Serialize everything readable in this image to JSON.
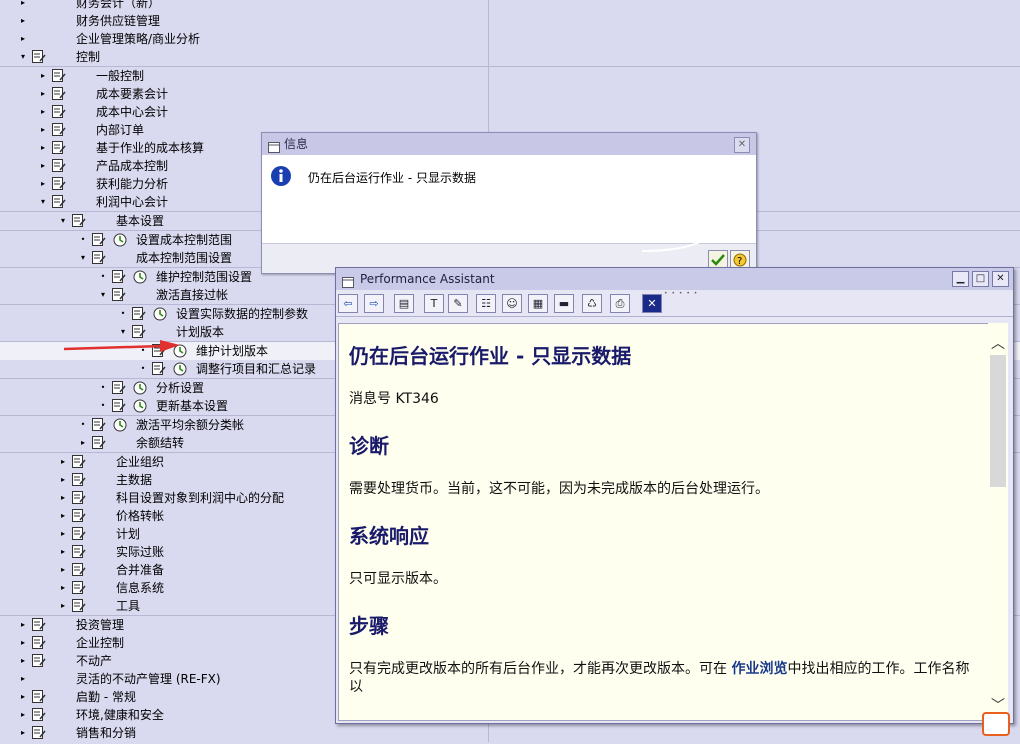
{
  "tree": [
    {
      "label": "财务会计（新）",
      "level": 0,
      "exp": "▸",
      "icon": "none",
      "sep": false
    },
    {
      "label": "财务供应链管理",
      "level": 0,
      "exp": "▸",
      "icon": "none",
      "sep": false
    },
    {
      "label": "企业管理策略/商业分析",
      "level": 0,
      "exp": "▸",
      "icon": "none",
      "sep": false
    },
    {
      "label": "控制",
      "level": 0,
      "exp": "▾",
      "icon": "doc",
      "sep": true
    },
    {
      "label": "一般控制",
      "level": 1,
      "exp": "▸",
      "icon": "doc",
      "sep": false
    },
    {
      "label": "成本要素会计",
      "level": 1,
      "exp": "▸",
      "icon": "doc",
      "sep": false
    },
    {
      "label": "成本中心会计",
      "level": 1,
      "exp": "▸",
      "icon": "doc",
      "sep": false
    },
    {
      "label": "内部订单",
      "level": 1,
      "exp": "▸",
      "icon": "doc",
      "sep": false
    },
    {
      "label": "基于作业的成本核算",
      "level": 1,
      "exp": "▸",
      "icon": "doc",
      "sep": false
    },
    {
      "label": "产品成本控制",
      "level": 1,
      "exp": "▸",
      "icon": "doc",
      "sep": false
    },
    {
      "label": "获利能力分析",
      "level": 1,
      "exp": "▸",
      "icon": "doc",
      "sep": false
    },
    {
      "label": "利润中心会计",
      "level": 1,
      "exp": "▾",
      "icon": "doc",
      "sep": true
    },
    {
      "label": "基本设置",
      "level": 2,
      "exp": "▾",
      "icon": "doc",
      "sep": true
    },
    {
      "label": "设置成本控制范围",
      "level": 3,
      "exp": "•",
      "icon": "doc-clock",
      "sep": false
    },
    {
      "label": "成本控制范围设置",
      "level": 3,
      "exp": "▾",
      "icon": "doc",
      "sep": true
    },
    {
      "label": "维护控制范围设置",
      "level": 4,
      "exp": "•",
      "icon": "doc-clock",
      "sep": false
    },
    {
      "label": "激活直接过帐",
      "level": 4,
      "exp": "▾",
      "icon": "doc",
      "sep": true
    },
    {
      "label": "设置实际数据的控制参数",
      "level": 5,
      "exp": "•",
      "icon": "doc-clock",
      "sep": false
    },
    {
      "label": "计划版本",
      "level": 5,
      "exp": "▾",
      "icon": "doc",
      "sep": true
    },
    {
      "label": "维护计划版本",
      "level": 6,
      "exp": "•",
      "icon": "doc-clock",
      "sep": false,
      "highlight": true
    },
    {
      "label": "调整行项目和汇总记录",
      "level": 6,
      "exp": "•",
      "icon": "doc-clock",
      "sep": true
    },
    {
      "label": "分析设置",
      "level": 4,
      "exp": "•",
      "icon": "doc-clock",
      "sep": false
    },
    {
      "label": "更新基本设置",
      "level": 4,
      "exp": "•",
      "icon": "doc-clock",
      "sep": true
    },
    {
      "label": "激活平均余额分类帐",
      "level": 3,
      "exp": "•",
      "icon": "doc-clock",
      "sep": false
    },
    {
      "label": "余额结转",
      "level": 3,
      "exp": "▸",
      "icon": "doc",
      "sep": true
    },
    {
      "label": "企业组织",
      "level": 2,
      "exp": "▸",
      "icon": "doc",
      "sep": false
    },
    {
      "label": "主数据",
      "level": 2,
      "exp": "▸",
      "icon": "doc",
      "sep": false
    },
    {
      "label": "科目设置对象到利润中心的分配",
      "level": 2,
      "exp": "▸",
      "icon": "doc",
      "sep": false
    },
    {
      "label": "价格转帐",
      "level": 2,
      "exp": "▸",
      "icon": "doc",
      "sep": false
    },
    {
      "label": "计划",
      "level": 2,
      "exp": "▸",
      "icon": "doc",
      "sep": false
    },
    {
      "label": "实际过账",
      "level": 2,
      "exp": "▸",
      "icon": "doc",
      "sep": false
    },
    {
      "label": "合并准备",
      "level": 2,
      "exp": "▸",
      "icon": "doc",
      "sep": false
    },
    {
      "label": "信息系统",
      "level": 2,
      "exp": "▸",
      "icon": "doc",
      "sep": false
    },
    {
      "label": "工具",
      "level": 2,
      "exp": "▸",
      "icon": "doc",
      "sep": true
    },
    {
      "label": "投资管理",
      "level": 0,
      "exp": "▸",
      "icon": "doc",
      "sep": false
    },
    {
      "label": "企业控制",
      "level": 0,
      "exp": "▸",
      "icon": "doc",
      "sep": false
    },
    {
      "label": "不动产",
      "level": 0,
      "exp": "▸",
      "icon": "doc",
      "sep": false
    },
    {
      "label": "灵活的不动产管理 (RE-FX)",
      "level": 0,
      "exp": "▸",
      "icon": "none",
      "sep": false
    },
    {
      "label": "启勤 - 常规",
      "level": 0,
      "exp": "▸",
      "icon": "doc",
      "sep": false
    },
    {
      "label": "环境,健康和安全",
      "level": 0,
      "exp": "▸",
      "icon": "doc",
      "sep": false
    },
    {
      "label": "销售和分销",
      "level": 0,
      "exp": "▸",
      "icon": "doc",
      "sep": false
    }
  ],
  "info_dialog": {
    "title": "信息",
    "message": "仍在后台运行作业 - 只显示数据"
  },
  "pa": {
    "title": "Performance Assistant",
    "heading": "仍在后台运行作业  - 只显示数据",
    "msg_no": "消息号  KT346",
    "h_diag": "诊断",
    "p_diag": "需要处理货币。当前，这不可能，因为未完成版本的后台处理运行。",
    "h_resp": "系统响应",
    "p_resp": "只可显示版本。",
    "h_steps": "步骤",
    "p_steps_a": "只有完成更改版本的所有后台作业，才能再次更改版本。可在 ",
    "p_steps_link": "作业浏览",
    "p_steps_b": "中找出相应的工作。工作名称以"
  },
  "toolbar_icons": [
    "back-icon",
    "forward-icon",
    "book-icon",
    "technical-info-icon",
    "edit-icon",
    "structure-icon",
    "users-icon",
    "table-icon",
    "notes-icon",
    "trash-icon",
    "print-icon",
    "close-icon"
  ],
  "colors": {
    "background": "#d9d9f0",
    "help_bg": "#fffff0",
    "heading": "#1a1a6a",
    "arrow": "#e03030"
  }
}
